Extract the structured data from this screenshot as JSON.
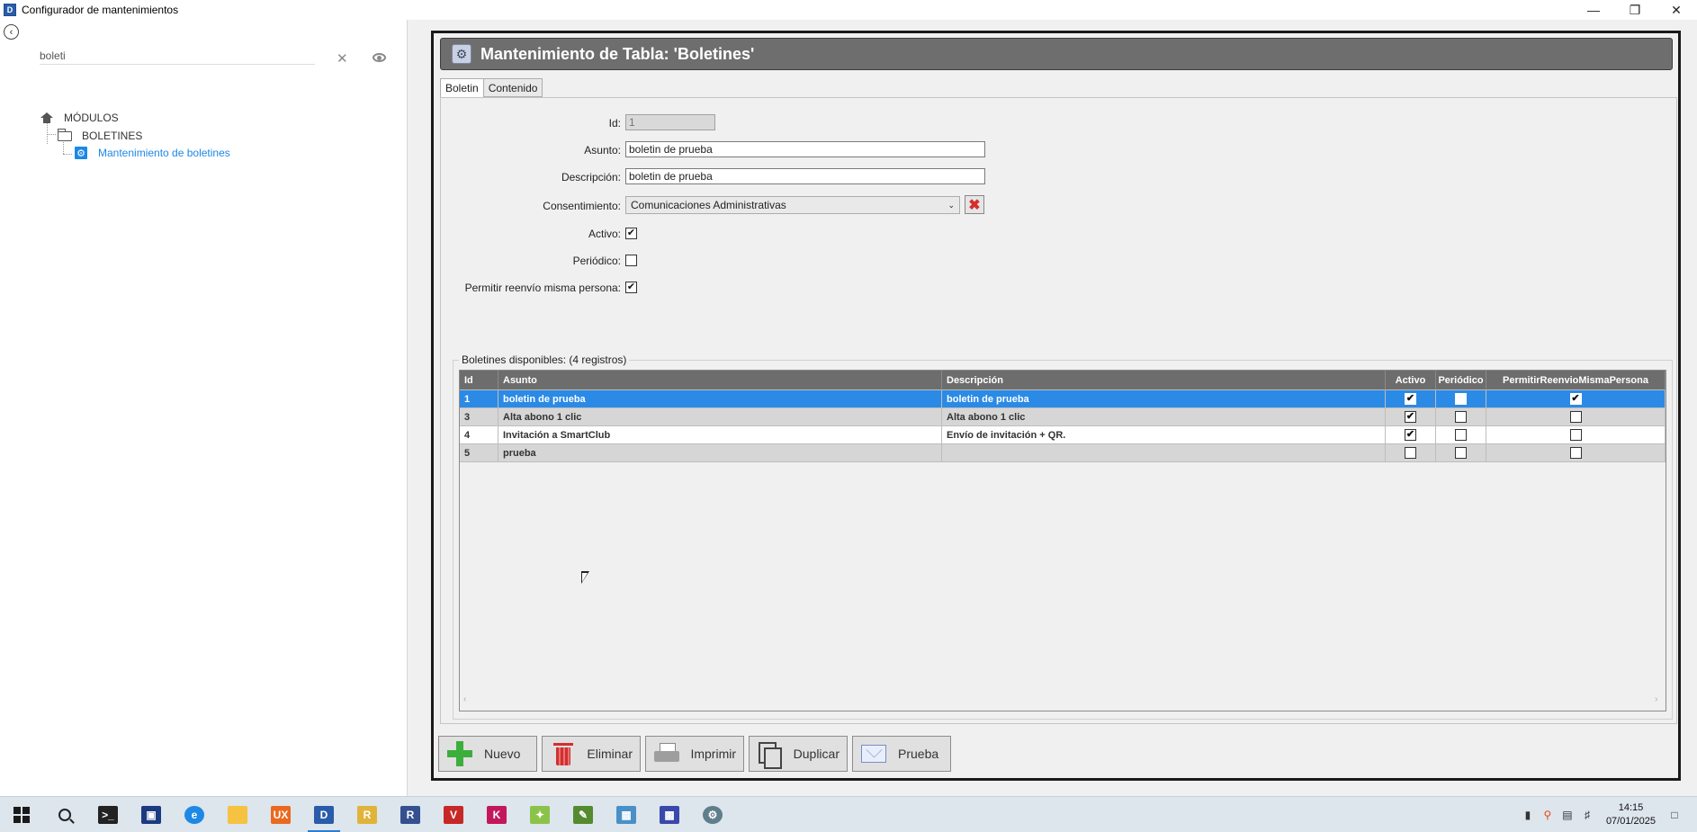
{
  "window": {
    "title": "Configurador de mantenimientos",
    "app_icon_letter": "D",
    "controls": {
      "minimize": "—",
      "restore": "❐",
      "close": "✕"
    }
  },
  "left_panel": {
    "search": {
      "value": "boleti",
      "placeholder": ""
    },
    "tree": [
      {
        "label": "MÓDULOS",
        "icon": "home-icon",
        "level": 0
      },
      {
        "label": "BOLETINES",
        "icon": "folder-icon",
        "level": 1
      },
      {
        "label": "Mantenimiento de boletines",
        "icon": "settings-icon",
        "level": 2,
        "color": "#1e88e5"
      }
    ]
  },
  "header": {
    "title": "Mantenimiento de Tabla: 'Boletines'"
  },
  "tabs": [
    {
      "label": "Boletin",
      "active": true
    },
    {
      "label": "Contenido",
      "active": false
    }
  ],
  "form": {
    "id": {
      "label": "Id:",
      "value": "1"
    },
    "asunto": {
      "label": "Asunto:",
      "value": "boletin de prueba"
    },
    "descripcion": {
      "label": "Descripción:",
      "value": "boletin de prueba"
    },
    "consentimiento": {
      "label": "Consentimiento:",
      "value": "Comunicaciones Administrativas"
    },
    "activo": {
      "label": "Activo:",
      "checked": true
    },
    "periodico": {
      "label": "Periódico:",
      "checked": false
    },
    "reenvio": {
      "label": "Permitir reenvío misma persona:",
      "checked": true
    }
  },
  "grid": {
    "legend": "Boletines disponibles:  (4 registros)",
    "columns": [
      "Id",
      "Asunto",
      "Descripción",
      "Activo",
      "Periódico",
      "PermitirReenvioMismaPersona"
    ],
    "rows": [
      {
        "id": "1",
        "asunto": "boletin de prueba",
        "descripcion": "boletin de prueba",
        "activo": true,
        "periodico": false,
        "reenvio": true,
        "selected": true
      },
      {
        "id": "3",
        "asunto": "Alta abono 1 clic",
        "descripcion": "Alta abono 1 clic",
        "activo": true,
        "periodico": false,
        "reenvio": false,
        "selected": false
      },
      {
        "id": "4",
        "asunto": "Invitación a SmartClub",
        "descripcion": "Envío de invitación + QR.",
        "activo": true,
        "periodico": false,
        "reenvio": false,
        "selected": false
      },
      {
        "id": "5",
        "asunto": "prueba",
        "descripcion": "",
        "activo": false,
        "periodico": false,
        "reenvio": false,
        "selected": false
      }
    ]
  },
  "buttons": {
    "nuevo": "Nuevo",
    "eliminar": "Eliminar",
    "imprimir": "Imprimir",
    "duplicar": "Duplicar",
    "prueba": "Prueba"
  },
  "taskbar": {
    "apps": [
      "start",
      "search",
      "terminal",
      "monitor",
      "edge",
      "explorer",
      "UX",
      "D",
      "R",
      "R",
      "V",
      "K",
      "tool",
      "editor",
      "calculator",
      "cube",
      "settings"
    ],
    "clock_time": "14:15",
    "clock_date": "07/01/2025"
  },
  "colors": {
    "selected_row": "#2b8ae6",
    "header_bar": "#6e6e6e",
    "accent": "#1e88e5"
  }
}
